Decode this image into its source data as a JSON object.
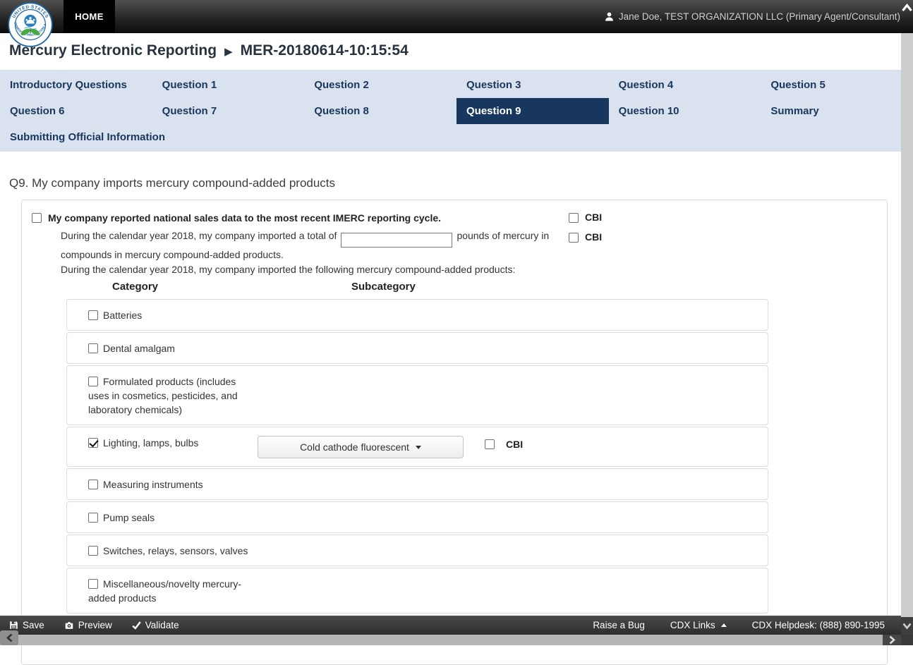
{
  "header": {
    "home": "HOME",
    "user_name": "Jane Doe, TEST ORGANIZATION LLC (Primary Agent/Consultant)"
  },
  "banner": {
    "app_title": "Mercury Electronic Reporting",
    "separator": "▶",
    "report_id": "MER-20180614-10:15:54"
  },
  "nav": {
    "active_tab": "Question 9",
    "tabs": [
      {
        "label": "Introductory Questions"
      },
      {
        "label": "Question 1"
      },
      {
        "label": "Question 2"
      },
      {
        "label": "Question 3"
      },
      {
        "label": "Question 4"
      },
      {
        "label": "Question 5"
      },
      {
        "label": "Question 6"
      },
      {
        "label": "Question 7"
      },
      {
        "label": "Question 8"
      },
      {
        "label": "Question 9"
      },
      {
        "label": "Question 10"
      },
      {
        "label": "Summary"
      },
      {
        "label": "Submitting Official Information"
      }
    ]
  },
  "q9": {
    "heading": "Q9. My company imports mercury compound-added products",
    "sales_statement": "My company reported national sales data to the most recent IMERC reporting cycle.",
    "sales_checked": false,
    "cbi_label": "CBI",
    "sales_cbi_checked": false,
    "total_prefix": "During the calendar year 2018, my company imported a total of",
    "total_input_value": "",
    "total_suffix": "pounds of mercury in",
    "total_continuation": "compounds in mercury compound-added products.",
    "total_cbi_checked": false,
    "products_intro": "During the calendar year 2018, my company imported the following mercury compound-added products:",
    "table": {
      "category_header": "Category",
      "subcategory_header": "Subcategory",
      "rows": [
        {
          "category": "Batteries",
          "checked": false
        },
        {
          "category": "Dental amalgam",
          "checked": false
        },
        {
          "category": "Formulated products (includes uses in cosmetics, pesticides, and laboratory chemicals)",
          "checked": false
        },
        {
          "category": "Lighting, lamps, bulbs",
          "checked": true,
          "subcategory_selected": "Cold cathode fluorescent",
          "cbi_label": "CBI",
          "cbi_checked": false
        },
        {
          "category": "Measuring instruments",
          "checked": false
        },
        {
          "category": "Pump seals",
          "checked": false
        },
        {
          "category": "Switches, relays, sensors, valves",
          "checked": false
        },
        {
          "category": "Miscellaneous/novelty mercury-added products",
          "checked": false
        }
      ]
    }
  },
  "footer": {
    "save": "Save",
    "preview": "Preview",
    "validate": "Validate",
    "raise_a_bug": "Raise a Bug",
    "cdx_links": "CDX Links",
    "helpdesk": "CDX Helpdesk: (888) 890-1995"
  },
  "icons": {
    "logo": "epa-seal",
    "user": "person-silhouette",
    "save": "floppy-disk",
    "preview": "camera",
    "validate": "checkmark",
    "cdx_links_caret": "up-triangle",
    "subcategory_caret": "down-triangle",
    "title_separator": "right-triangle"
  },
  "colors": {
    "accent_navy": "#17375e",
    "nav_background": "#dbe2ef",
    "header_black": "#000000",
    "footer_dark": "#2d2d2d",
    "row_border": "#dcdcdc"
  }
}
